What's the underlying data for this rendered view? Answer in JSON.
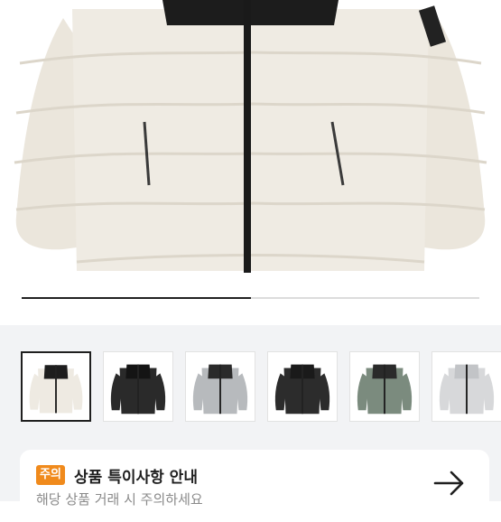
{
  "product": {
    "image_alt": "North Face Nuptse puffer jacket, cream",
    "carousel_progress": 0.5
  },
  "thumbnails": [
    {
      "name": "cream-black",
      "body_color": "#eeeae2",
      "yoke_color": "#1d1d1d",
      "selected": true
    },
    {
      "name": "black-glossy",
      "body_color": "#2a2a2a",
      "yoke_color": "#141414",
      "selected": false
    },
    {
      "name": "grey-black",
      "body_color": "#b7babd",
      "yoke_color": "#2a2a2a",
      "selected": false
    },
    {
      "name": "black-matte",
      "body_color": "#2c2c2c",
      "yoke_color": "#1a1a1a",
      "selected": false
    },
    {
      "name": "sage-black",
      "body_color": "#7b8b7e",
      "yoke_color": "#2a2a2a",
      "selected": false
    },
    {
      "name": "silver",
      "body_color": "#d7d8da",
      "yoke_color": "#c2c4c7",
      "selected": false
    }
  ],
  "notice": {
    "badge": "주의",
    "title": "상품 특이사항 안내",
    "subtitle": "해당 상품 거래 시 주의하세요"
  },
  "colors": {
    "accent": "#f08a1c",
    "band": "#f2f3f5"
  },
  "icons": {
    "notice_arrow": "arrow-right-icon"
  }
}
